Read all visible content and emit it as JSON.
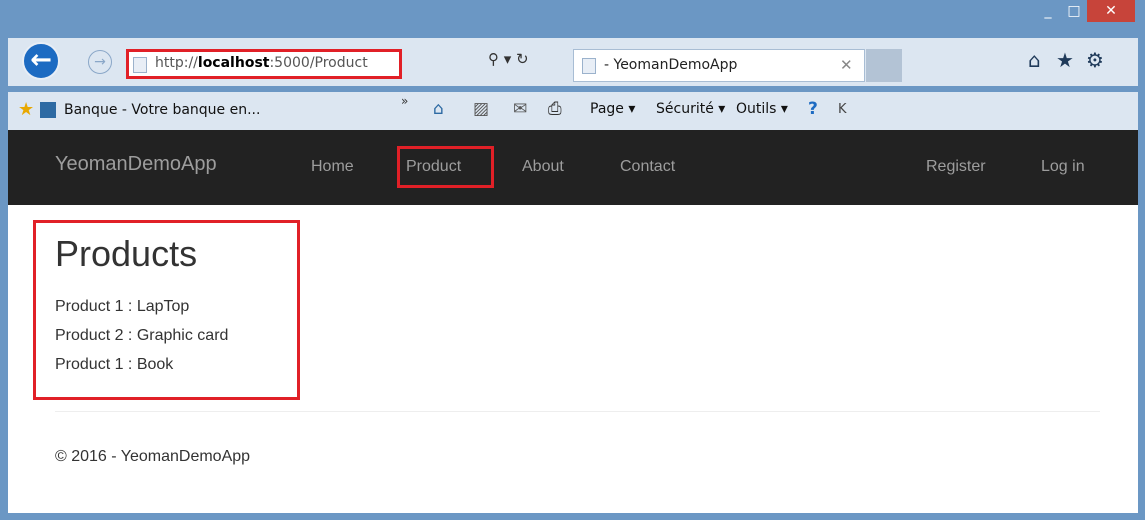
{
  "window": {
    "minimize": "_",
    "maximize": "□",
    "close": "✕"
  },
  "browser": {
    "back": "←",
    "forward": "→",
    "address_prefix": "http://",
    "address_host": "localhost",
    "address_rest": ":5000/Product",
    "search_controls": "⚲ ▾ ↻",
    "tab_title": "- YeomanDemoApp",
    "tab_close": "✕",
    "home_icon": "⌂",
    "star_icon": "★",
    "gear_icon": "⚙"
  },
  "favorites": {
    "star": "★",
    "bookmark_label": "Banque - Votre banque en...",
    "chevron": "»",
    "commands": {
      "page": "Page ▾",
      "security": "Sécurité ▾",
      "tools": "Outils ▾"
    },
    "icons": {
      "home": "⌂",
      "rss": "▨",
      "mail": "✉",
      "print": "⎙",
      "help": "?",
      "k": "K"
    }
  },
  "site": {
    "brand": "YeomanDemoApp",
    "nav": [
      "Home",
      "Product",
      "About",
      "Contact"
    ],
    "nav_right": [
      "Register",
      "Log in"
    ],
    "heading": "Products",
    "products": [
      "Product 1 : LapTop",
      "Product 2 : Graphic card",
      "Product 1 : Book"
    ],
    "footer": "© 2016 - YeomanDemoApp"
  },
  "colors": {
    "highlight": "#e12027",
    "navbar": "#222222",
    "frame": "#6b97c4"
  }
}
